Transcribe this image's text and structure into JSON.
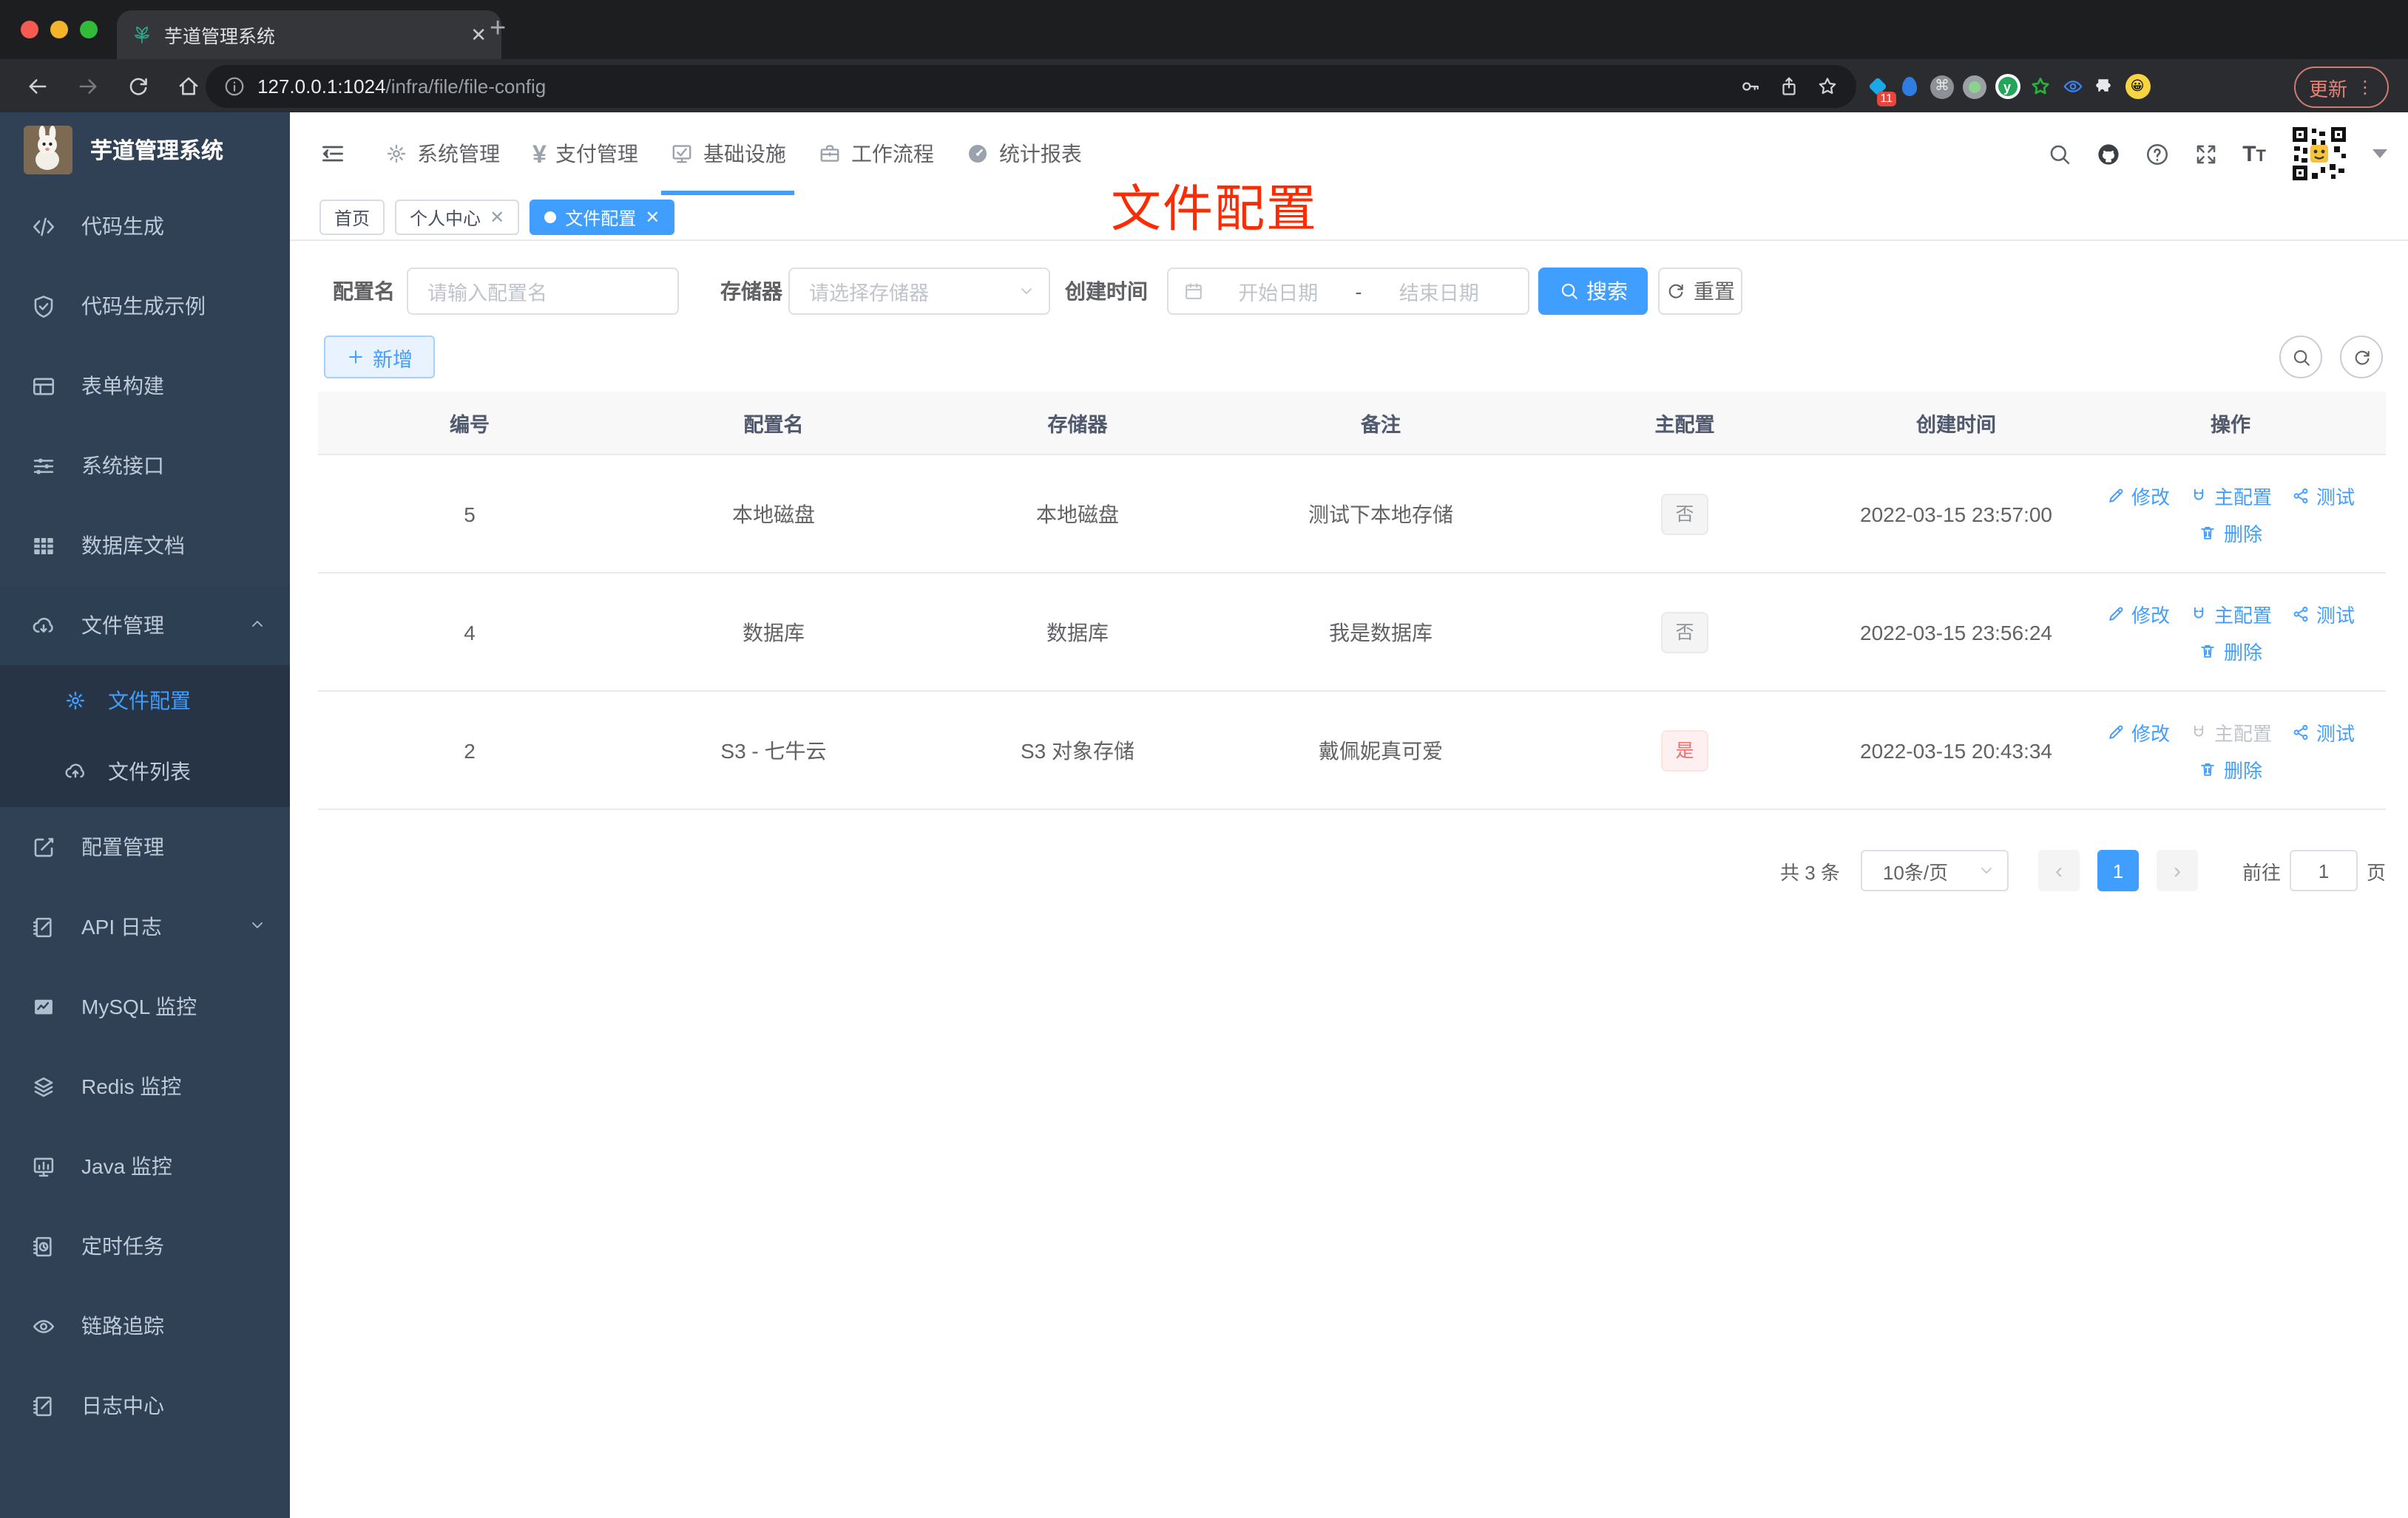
{
  "browser": {
    "tab_title": "芋道管理系统",
    "url_host": "127.0.0.1:1024",
    "url_path": "/infra/file/file-config",
    "ext_badge": "11",
    "update_label": "更新"
  },
  "annotation": "文件配置",
  "sidebar": {
    "logo_title": "芋道管理系统",
    "items": [
      {
        "label": "代码生成",
        "icon": "code"
      },
      {
        "label": "代码生成示例",
        "icon": "shield"
      },
      {
        "label": "表单构建",
        "icon": "form"
      },
      {
        "label": "系统接口",
        "icon": "sliders"
      },
      {
        "label": "数据库文档",
        "icon": "dbtable"
      },
      {
        "label": "文件管理",
        "icon": "cloud-down",
        "expanded": true,
        "children": [
          {
            "label": "文件配置",
            "icon": "gear",
            "active": true
          },
          {
            "label": "文件列表",
            "icon": "cloud-up"
          }
        ]
      },
      {
        "label": "配置管理",
        "icon": "edit-square"
      },
      {
        "label": "API 日志",
        "icon": "note-pencil",
        "collapsed": true
      },
      {
        "label": "MySQL 监控",
        "icon": "chart-monitor"
      },
      {
        "label": "Redis 监控",
        "icon": "layers"
      },
      {
        "label": "Java 监控",
        "icon": "monitor"
      },
      {
        "label": "定时任务",
        "icon": "clock-doc"
      },
      {
        "label": "链路追踪",
        "icon": "eye"
      },
      {
        "label": "日志中心",
        "icon": "note-pencil"
      }
    ]
  },
  "navbar": {
    "menus": [
      {
        "label": "系统管理",
        "icon": "gear"
      },
      {
        "label": "支付管理",
        "icon": "yen"
      },
      {
        "label": "基础设施",
        "icon": "infra",
        "active": true
      },
      {
        "label": "工作流程",
        "icon": "briefcase"
      },
      {
        "label": "统计报表",
        "icon": "gauge"
      }
    ]
  },
  "tags": [
    {
      "label": "首页"
    },
    {
      "label": "个人中心",
      "closable": true
    },
    {
      "label": "文件配置",
      "closable": true,
      "active": true
    }
  ],
  "filters": {
    "name_label": "配置名",
    "name_placeholder": "请输入配置名",
    "storage_label": "存储器",
    "storage_placeholder": "请选择存储器",
    "date_label": "创建时间",
    "date_start_placeholder": "开始日期",
    "date_separator": "-",
    "date_end_placeholder": "结束日期",
    "search_label": "搜索",
    "reset_label": "重置"
  },
  "toolbar": {
    "add_label": "新增"
  },
  "table": {
    "columns": [
      "编号",
      "配置名",
      "存储器",
      "备注",
      "主配置",
      "创建时间",
      "操作"
    ],
    "rows": [
      {
        "id": "5",
        "name": "本地磁盘",
        "storage": "本地磁盘",
        "remark": "测试下本地存储",
        "master": "否",
        "master_type": "info",
        "created": "2022-03-15 23:57:00",
        "actions": [
          {
            "label": "修改",
            "icon": "pencil"
          },
          {
            "label": "主配置",
            "icon": "magnet"
          },
          {
            "label": "测试",
            "icon": "share"
          },
          {
            "label": "删除",
            "icon": "trash"
          }
        ]
      },
      {
        "id": "4",
        "name": "数据库",
        "storage": "数据库",
        "remark": "我是数据库",
        "master": "否",
        "master_type": "info",
        "created": "2022-03-15 23:56:24",
        "actions": [
          {
            "label": "修改",
            "icon": "pencil"
          },
          {
            "label": "主配置",
            "icon": "magnet"
          },
          {
            "label": "测试",
            "icon": "share"
          },
          {
            "label": "删除",
            "icon": "trash"
          }
        ]
      },
      {
        "id": "2",
        "name": "S3 - 七牛云",
        "storage": "S3 对象存储",
        "remark": "戴佩妮真可爱",
        "master": "是",
        "master_type": "danger",
        "created": "2022-03-15 20:43:34",
        "actions": [
          {
            "label": "修改",
            "icon": "pencil"
          },
          {
            "label": "主配置",
            "icon": "magnet",
            "disabled": true
          },
          {
            "label": "测试",
            "icon": "share"
          },
          {
            "label": "删除",
            "icon": "trash"
          }
        ]
      }
    ]
  },
  "pagination": {
    "total_text": "共 3 条",
    "page_size": "10条/页",
    "prev": "‹",
    "current": "1",
    "next": "›",
    "goto_label": "前往",
    "goto_value": "1",
    "unit_label": "页"
  }
}
